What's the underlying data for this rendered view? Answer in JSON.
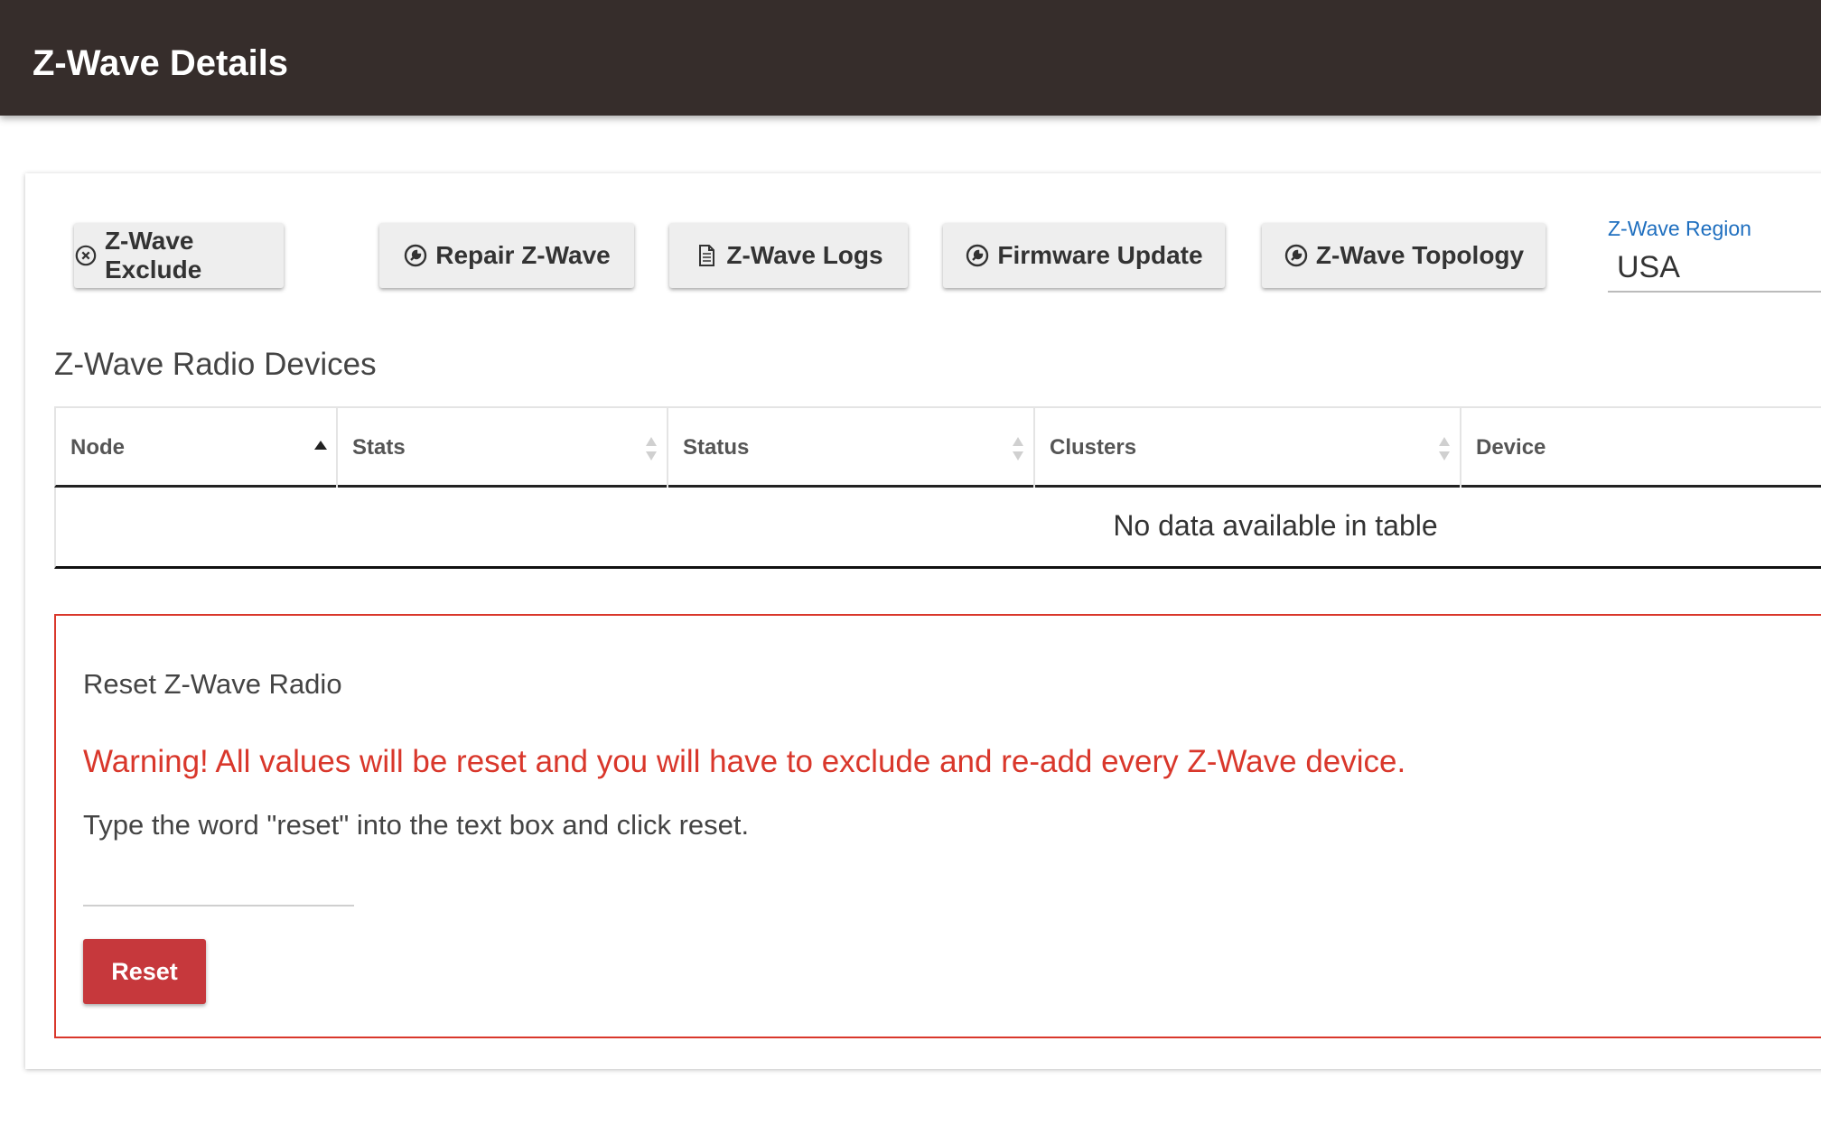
{
  "header": {
    "title": "Z-Wave Details"
  },
  "toolbar": {
    "buttons": [
      {
        "label": "Z-Wave Exclude",
        "icon": "circle-x-icon"
      },
      {
        "label": "Repair Z-Wave",
        "icon": "wrench-circle-icon"
      },
      {
        "label": "Z-Wave Logs",
        "icon": "document-icon"
      },
      {
        "label": "Firmware Update",
        "icon": "wrench-circle-icon"
      },
      {
        "label": "Z-Wave Topology",
        "icon": "wrench-circle-icon"
      }
    ]
  },
  "region": {
    "label": "Z-Wave Region",
    "value": "USA"
  },
  "devices": {
    "title": "Z-Wave Radio Devices",
    "columns": [
      "Node",
      "Stats",
      "Status",
      "Clusters",
      "Device"
    ],
    "sorted_column": "Node",
    "empty_text": "No data available in table"
  },
  "reset": {
    "title": "Reset Z-Wave Radio",
    "warning": "Warning! All values will be reset and you will have to exclude and re-add every Z-Wave device.",
    "hint": "Type the word \"reset\" into the text box and click reset.",
    "input_value": "",
    "button_label": "Reset",
    "warning_color": "#d9372b",
    "button_color": "#c6383c"
  }
}
